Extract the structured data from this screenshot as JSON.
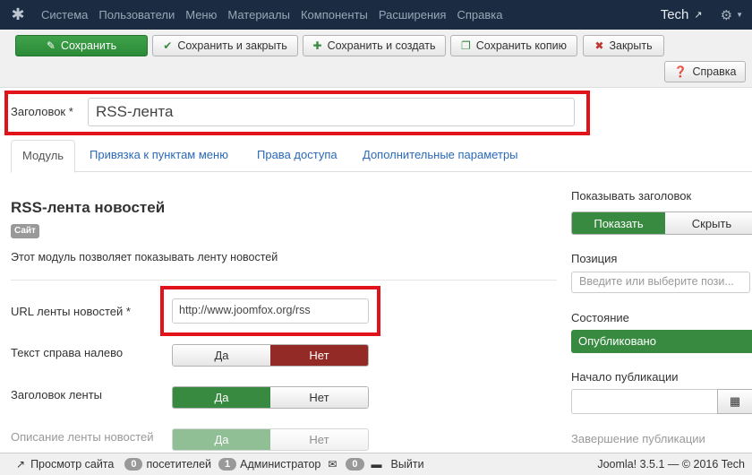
{
  "navbar": {
    "menu": [
      "Система",
      "Пользователи",
      "Меню",
      "Материалы",
      "Компоненты",
      "Расширения",
      "Справка"
    ],
    "site_name": "Tech"
  },
  "toolbar": {
    "save": "Сохранить",
    "save_close": "Сохранить и закрыть",
    "save_new": "Сохранить и создать",
    "save_copy": "Сохранить копию",
    "close": "Закрыть",
    "help": "Справка"
  },
  "title_field": {
    "label": "Заголовок *",
    "value": "RSS-лента"
  },
  "tabs": [
    "Модуль",
    "Привязка к пунктам меню",
    "Права доступа",
    "Дополнительные параметры"
  ],
  "module": {
    "title": "RSS-лента новостей",
    "badge": "Сайт",
    "description": "Этот модуль позволяет показывать ленту новостей"
  },
  "fields": {
    "url_label": "URL ленты новостей *",
    "url_value": "http://www.joomfox.org/rss",
    "rtl_label": "Текст справа налево",
    "rtl_yes": "Да",
    "rtl_no": "Нет",
    "feed_title_label": "Заголовок ленты",
    "feed_title_yes": "Да",
    "feed_title_no": "Нет",
    "feed_desc_label": "Описание ленты новостей",
    "feed_desc_yes": "Да",
    "feed_desc_no": "Нет"
  },
  "sidebar": {
    "show_title_label": "Показывать заголовок",
    "show": "Показать",
    "hide": "Скрыть",
    "position_label": "Позиция",
    "position_placeholder": "Введите или выберите пози...",
    "status_label": "Состояние",
    "status_value": "Опубликовано",
    "publish_start_label": "Начало публикации",
    "publish_end_label": "Завершение публикации"
  },
  "statusbar": {
    "view_site": "Просмотр сайта",
    "visitors_count": "0",
    "visitors": "посетителей",
    "admins_count": "1",
    "admins": "Администратор",
    "messages_count": "0",
    "logout": "Выйти",
    "version": "Joomla! 3.5.1 — © 2016 Tech"
  },
  "colors": {
    "navbar": "#1a2b42",
    "green": "#378a3f",
    "red_highlight": "#e2121b",
    "toggle_red": "#942a25",
    "link": "#2a69b8"
  }
}
